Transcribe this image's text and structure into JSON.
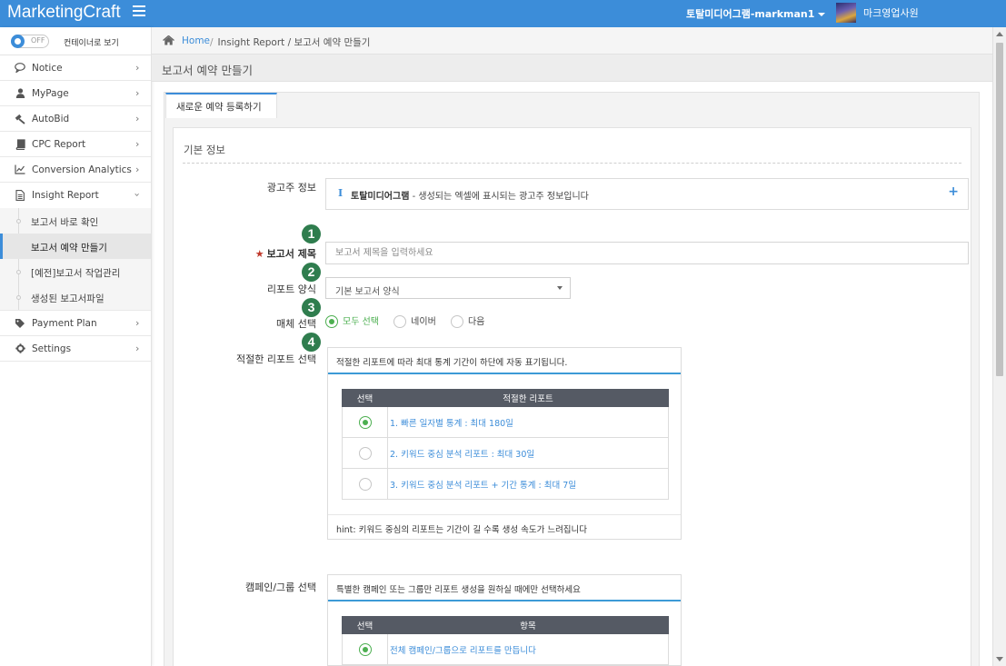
{
  "topbar": {
    "brand": "MarketingCraft",
    "user": "토탈미디어그램-markman1",
    "role": "마크영업사원"
  },
  "sidebar": {
    "toggle_state": "OFF",
    "toggle_label": "컨테이너로 보기",
    "items": [
      {
        "label": "Notice",
        "icon": "comment-icon"
      },
      {
        "label": "MyPage",
        "icon": "user-icon"
      },
      {
        "label": "AutoBid",
        "icon": "gavel-icon"
      },
      {
        "label": "CPC Report",
        "icon": "book-icon"
      },
      {
        "label": "Conversion Analytics",
        "icon": "line-chart-icon"
      },
      {
        "label": "Insight Report",
        "icon": "document-icon"
      },
      {
        "label": "Payment Plan",
        "icon": "tag-icon"
      },
      {
        "label": "Settings",
        "icon": "gear-icon"
      }
    ],
    "sub_items": [
      {
        "label": "보고서 바로 확인"
      },
      {
        "label": "보고서 예약 만들기"
      },
      {
        "label": "[예전]보고서 작업관리"
      },
      {
        "label": "생성된 보고서파일"
      }
    ]
  },
  "breadcrumb": {
    "home": "Home",
    "rest": "Insight Report / 보고서 예약 만들기"
  },
  "page": {
    "title": "보고서 예약 만들기",
    "tab": "새로운 예약 등록하기",
    "section": "기본 정보"
  },
  "form": {
    "advertiser_label": "광고주 정보",
    "advertiser_name": "토탈미디어그램",
    "advertiser_desc": " - 생성되는 엑셀에 표시되는 광고주 정보입니다",
    "report_title_label": "보고서 제목",
    "report_title_placeholder": "보고서 제목을 입력하세요",
    "template_label": "리포트 양식",
    "template_value": "기본 보고서 양식",
    "media_label": "매체 선택",
    "media_options": [
      "모두 선택",
      "네이버",
      "다음"
    ],
    "media_selected": "모두 선택",
    "report_select_label": "적절한 리포트 선택",
    "campaign_label": "캠페인/그룹 선택"
  },
  "report_card": {
    "head": "적절한 리포트에 따라 최대 통계 기간이 하단에 자동 표기됩니다.",
    "columns": [
      "선택",
      "적절한 리포트"
    ],
    "rows": [
      {
        "label": "1. 빠른 일자별 통계 : 최대 180일",
        "selected": true
      },
      {
        "label": "2. 키워드 중심 분석 리포트 : 최대 30일",
        "selected": false
      },
      {
        "label": "3. 키워드 중심 분석 리포트 + 기간 통계 : 최대 7일",
        "selected": false
      }
    ],
    "hint": "hint: 키워드 중심의 리포트는 기간이 길 수록 생성 속도가 느려집니다"
  },
  "campaign_card": {
    "head": "특별한 캠페인 또는 그룹만 리포트 생성을 원하실 때에만 선택하세요",
    "columns": [
      "선택",
      "항목"
    ],
    "rows": [
      {
        "label": "전체 캠페인/그룹으로 리포트를 만듭니다",
        "selected": true
      }
    ]
  },
  "callouts": [
    "1",
    "2",
    "3",
    "4"
  ],
  "colors": {
    "primary": "#3c8dd9",
    "selected_green": "#4caf50",
    "callout": "#2f7d4e",
    "required_star": "#c0392b"
  }
}
